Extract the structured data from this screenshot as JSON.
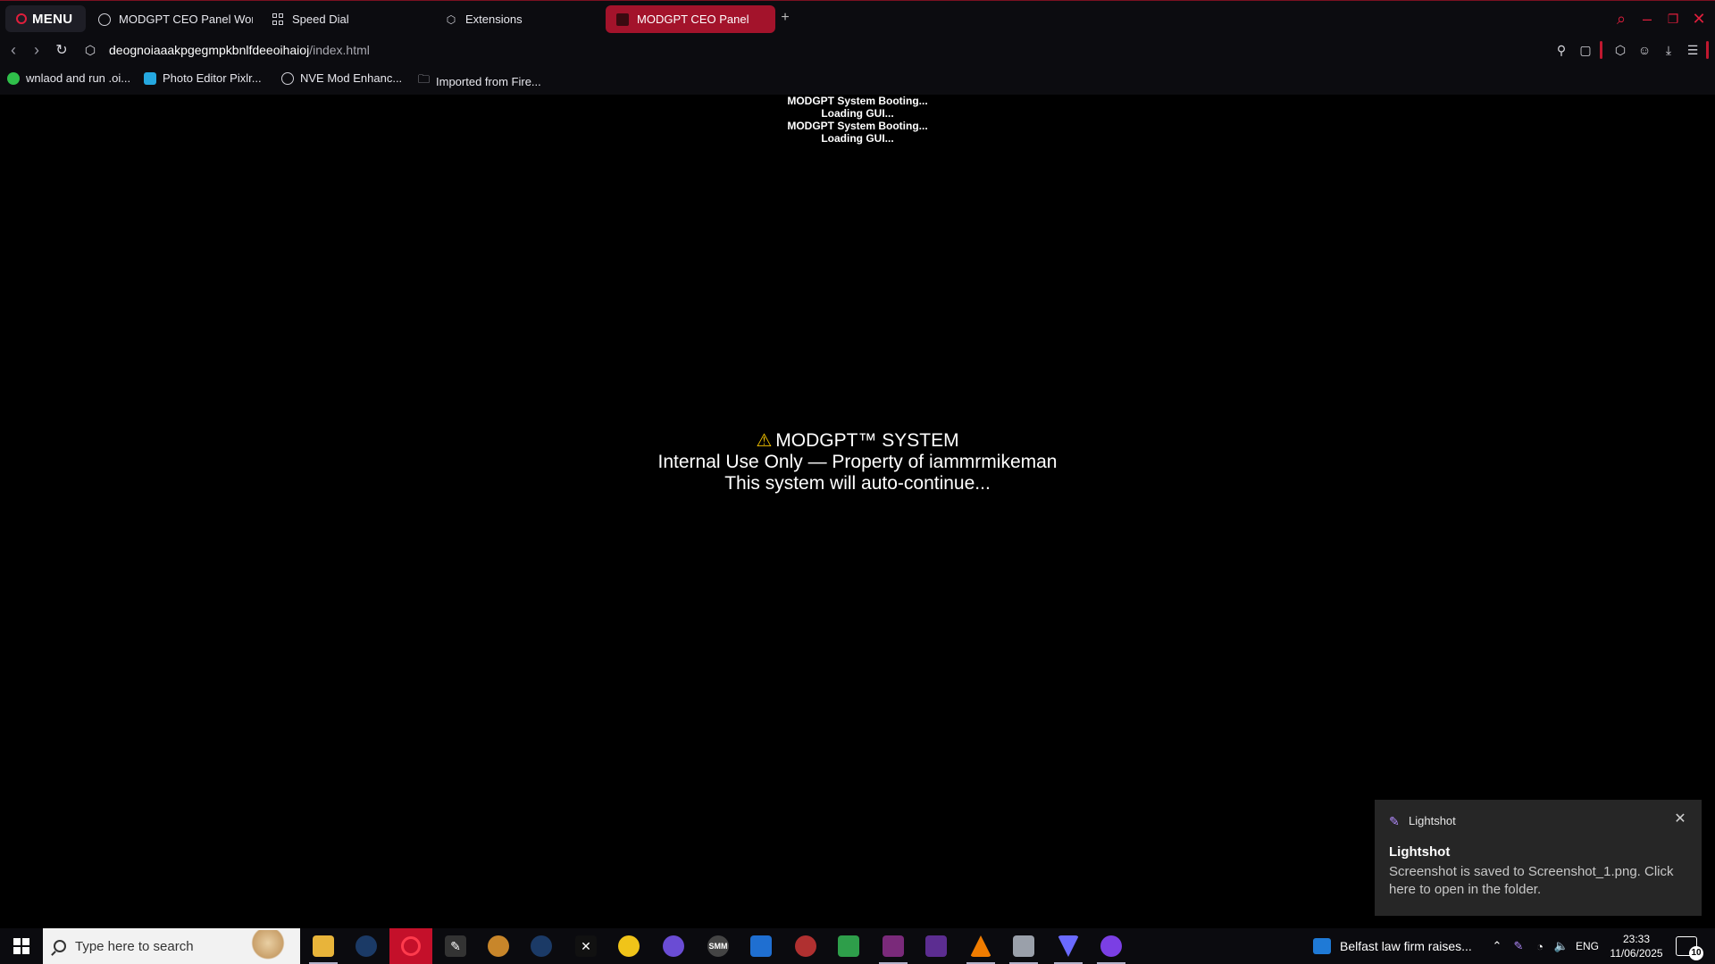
{
  "browser": {
    "menu_label": "MENU",
    "tabs": [
      {
        "label": "MODGPT CEO Panel Work",
        "icon": "globe-icon"
      },
      {
        "label": "Speed Dial",
        "icon": "grid-icon"
      },
      {
        "label": "Extensions",
        "icon": "cube-icon"
      },
      {
        "label": "MODGPT CEO Panel",
        "icon": "avatar-icon"
      }
    ],
    "url_host": "deognoiaaakpgegmpkbnlfdeeoihaioj",
    "url_path": "/index.html",
    "bookmarks": [
      {
        "label": "wnlaod and run .oi...",
        "color": "#2fbf4a"
      },
      {
        "label": "Photo Editor Pixlr...",
        "color": "#25a8e0"
      },
      {
        "label": "NVE Mod Enhanc...",
        "color": "#9a9aa4"
      },
      {
        "label": "Imported from Fire...",
        "icon": "folder-icon"
      }
    ],
    "accent_color": "#a3132b"
  },
  "page": {
    "boot_lines": [
      "MODGPT System Booting...",
      "Loading GUI...",
      "MODGPT System Booting...",
      "Loading GUI..."
    ],
    "notice": {
      "warning_glyph": "⚠",
      "line1": "MODGPT™ SYSTEM",
      "line2": "Internal Use Only — Property of iammrmikeman",
      "line3": "This system will auto-continue..."
    }
  },
  "toast": {
    "app_name": "Lightshot",
    "title": "Lightshot",
    "message": "Screenshot is saved to Screenshot_1.png. Click here to open in the folder."
  },
  "taskbar": {
    "search_placeholder": "Type here to search",
    "news_text": "Belfast law firm raises...",
    "language": "ENG",
    "time": "23:33",
    "date": "11/06/2025",
    "notification_count": "10"
  }
}
